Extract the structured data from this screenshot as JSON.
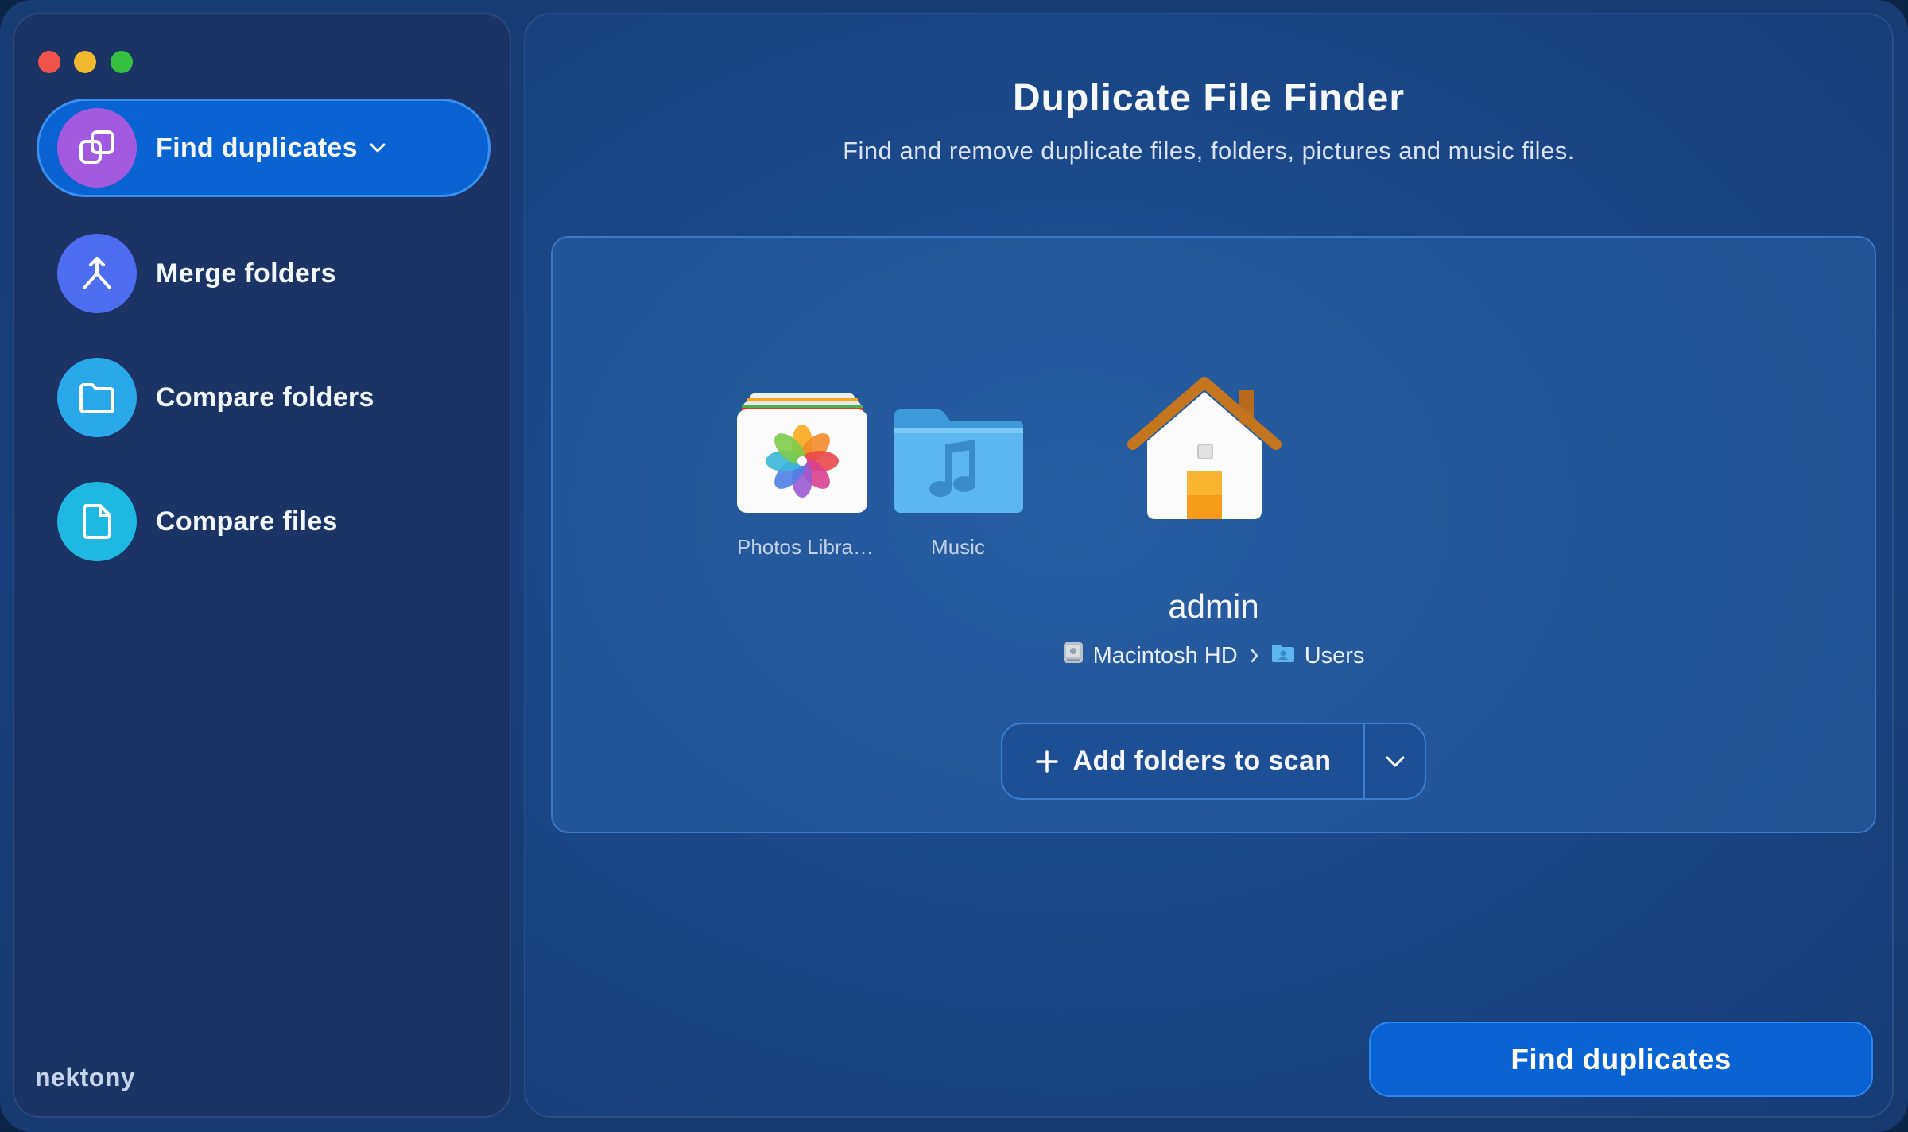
{
  "sidebar": {
    "items": [
      {
        "label": "Find duplicates",
        "icon": "copy-icon",
        "color": "#a35ae0",
        "active": true
      },
      {
        "label": "Merge folders",
        "icon": "merge-icon",
        "color": "#4d6ef0",
        "active": false
      },
      {
        "label": "Compare folders",
        "icon": "folder-icon",
        "color": "#29a8ea",
        "active": false
      },
      {
        "label": "Compare files",
        "icon": "file-icon",
        "color": "#1fb8e0",
        "active": false
      }
    ],
    "brand": "nektony"
  },
  "main": {
    "title": "Duplicate File Finder",
    "subtitle": "Find and remove duplicate files, folders, pictures and music files.",
    "folders": [
      {
        "caption": "Photos Libra…",
        "icon": "photos-library-icon"
      },
      {
        "caption": "Music",
        "icon": "music-folder-icon"
      },
      {
        "caption": "",
        "icon": "home-folder-icon"
      }
    ],
    "target": {
      "name": "admin",
      "path": [
        "Macintosh HD",
        "Users"
      ]
    },
    "add_button": "Add folders to scan",
    "primary_button": "Find duplicates"
  },
  "colors": {
    "accent": "#0a63d2",
    "sidebar_bg": "#1b3465",
    "window_bg": "#173d75"
  }
}
